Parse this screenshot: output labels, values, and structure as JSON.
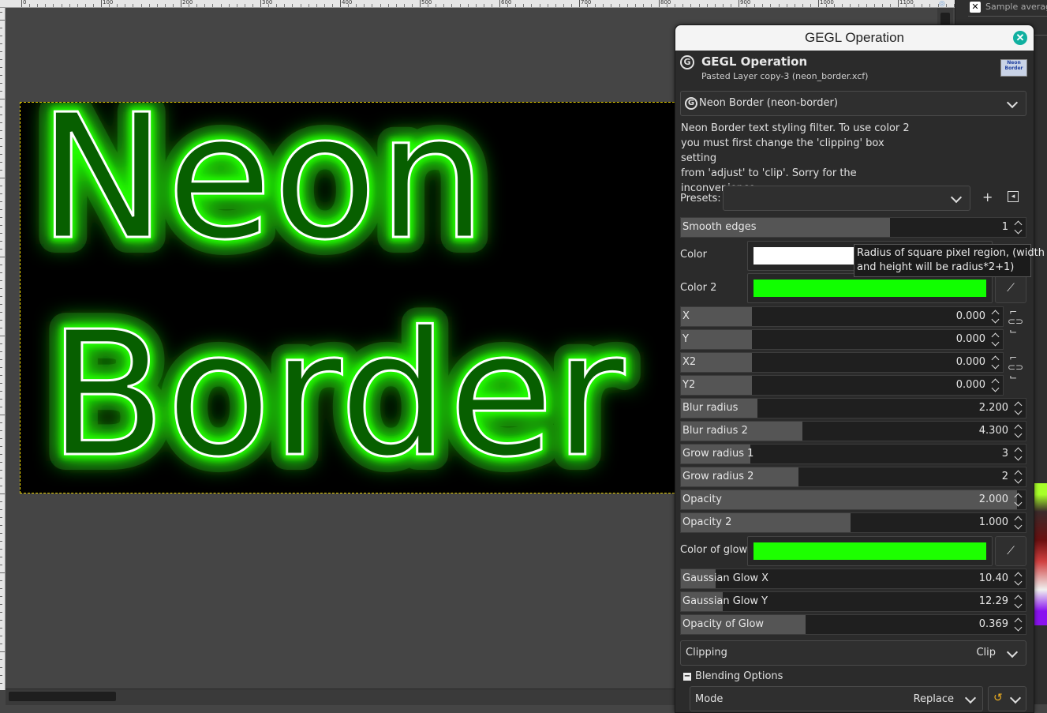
{
  "ruler": {
    "labels": [
      "0",
      "100",
      "200",
      "300",
      "400",
      "500",
      "600",
      "700",
      "800",
      "900",
      "1000",
      "1100"
    ]
  },
  "canvas": {
    "line1": "Neon",
    "line2": "Border",
    "neon_color": "#22ff00",
    "glow_core": "#ffffff"
  },
  "right_dock": {
    "close_label": "✕",
    "sample_label": "Sample average"
  },
  "dialog": {
    "window_title": "GEGL Operation",
    "close_label": "✕",
    "header_title": "GEGL Operation",
    "header_subtitle": "Pasted Layer copy-3 (neon_border.xcf)",
    "thumb_text": "Neon Border",
    "operation": "Neon Border (neon-border)",
    "description": [
      "Neon Border text styling filter. To use color 2",
      "you must first change the 'clipping' box setting",
      "from 'adjust' to 'clip'. Sorry for the",
      "inconvenience."
    ],
    "presets_label": "Presets:",
    "presets_value": "",
    "add_icon": "+",
    "menu_icon": "◂",
    "smooth_edges": {
      "label": "Smooth edges",
      "value": "1",
      "fill": 0.6
    },
    "color_label": "Color",
    "color_value": "#ffffff",
    "color2_label": "Color 2",
    "color2_value": "#11ff00",
    "tooltip": [
      "Radius of square pixel region, (width",
      "and height will be radius*2+1)"
    ],
    "xy": [
      {
        "label": "X",
        "value": "0.000",
        "fill": 0.22
      },
      {
        "label": "Y",
        "value": "0.000",
        "fill": 0.22
      },
      {
        "label": "X2",
        "value": "0.000",
        "fill": 0.22
      },
      {
        "label": "Y2",
        "value": "0.000",
        "fill": 0.22
      }
    ],
    "params": [
      {
        "label": "Blur radius",
        "value": "2.200",
        "fill": 0.22
      },
      {
        "label": "Blur radius 2",
        "value": "4.300",
        "fill": 0.35
      },
      {
        "label": "Grow radius 1",
        "value": "3",
        "fill": 0.2
      },
      {
        "label": "Grow radius 2",
        "value": "2",
        "fill": 0.34
      },
      {
        "label": "Opacity",
        "value": "2.000",
        "fill": 0.97
      },
      {
        "label": "Opacity 2",
        "value": "1.000",
        "fill": 0.49
      }
    ],
    "glow_color_label": "Color of glow",
    "glow_color_value": "#1dff00",
    "glow_params": [
      {
        "label": "Gaussian Glow X",
        "value": "10.40",
        "fill": 0.1
      },
      {
        "label": "Gaussian Glow Y",
        "value": "12.29",
        "fill": 0.12
      },
      {
        "label": "Opacity of Glow",
        "value": "0.369",
        "fill": 0.36
      }
    ],
    "clipping_label": "Clipping",
    "clipping_value": "Clip",
    "blending_label": "Blending Options",
    "blending_toggle": "−",
    "mode_label": "Mode",
    "mode_value": "Replace"
  }
}
